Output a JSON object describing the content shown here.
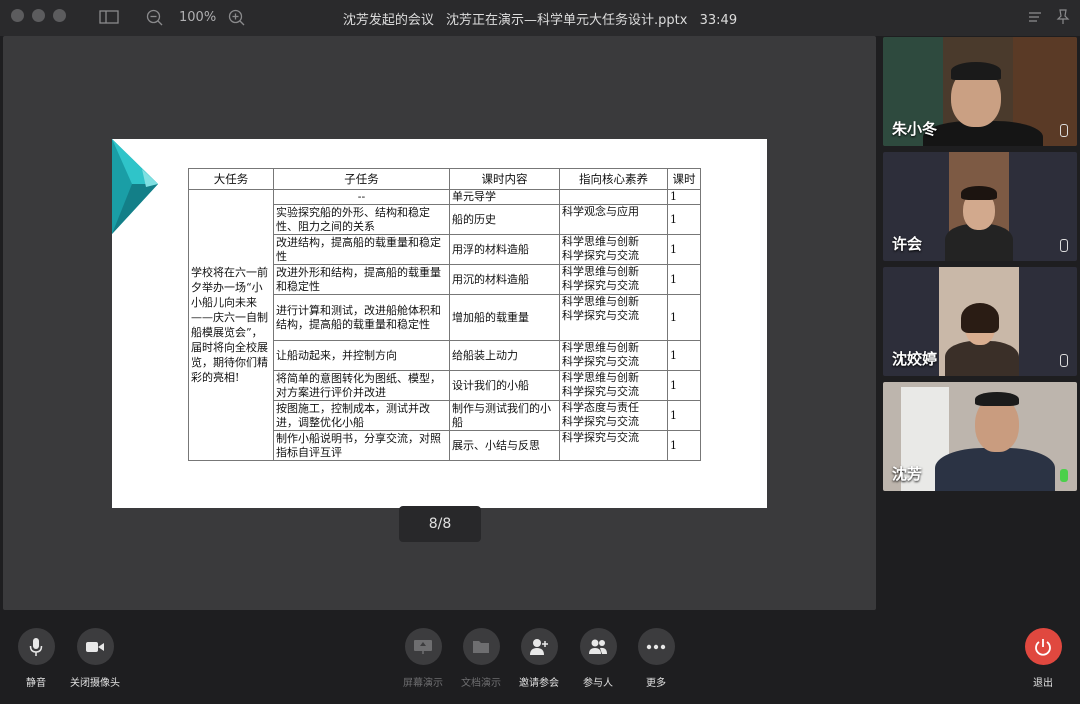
{
  "titlebar": {
    "zoom": "100%",
    "meeting_title": "沈芳发起的会议",
    "presenting": "沈芳正在演示—科学单元大任务设计.pptx",
    "timer": "33:49"
  },
  "slide": {
    "headers": [
      "大任务",
      "子任务",
      "课时内容",
      "指向核心素养",
      "课时"
    ],
    "main_task": "学校将在六一前夕举办一场“小小船儿向未来——庆六一自制船模展览会”，届时将向全校展览，期待你们精彩的亮相!",
    "rows": [
      {
        "sub": "--",
        "content": "单元导学",
        "literacy": "",
        "hours": "1"
      },
      {
        "sub": "实验探究船的外形、结构和稳定性、阻力之间的关系",
        "content": "船的历史",
        "literacy": "科学观念与应用",
        "hours": "1"
      },
      {
        "sub": "改进结构，提高船的载重量和稳定性",
        "content": "用浮的材料造船",
        "literacy": "科学思维与创新\n科学探究与交流",
        "hours": "1"
      },
      {
        "sub": "改进外形和结构，提高船的载重量和稳定性",
        "content": "用沉的材料造船",
        "literacy": "科学思维与创新\n科学探究与交流",
        "hours": "1"
      },
      {
        "sub": "进行计算和测试，改进船舱体积和结构，提高船的载重量和稳定性",
        "content": "增加船的载重量",
        "literacy": "科学思维与创新\n科学探究与交流",
        "hours": "1"
      },
      {
        "sub": "让船动起来，并控制方向",
        "content": "给船装上动力",
        "literacy": "科学思维与创新\n科学探究与交流",
        "hours": "1"
      },
      {
        "sub": "将简单的意图转化为图纸、模型，对方案进行评价并改进",
        "content": "设计我们的小船",
        "literacy": "科学思维与创新\n科学探究与交流",
        "hours": "1"
      },
      {
        "sub": "按图施工，控制成本，测试并改进，调整优化小船",
        "content": "制作与测试我们的小船",
        "literacy": "科学态度与责任\n科学探究与交流",
        "hours": "1"
      },
      {
        "sub": "制作小船说明书，分享交流，对照指标自评互评",
        "content": "展示、小结与反思",
        "literacy": "科学探究与交流",
        "hours": "1"
      }
    ]
  },
  "page_indicator": "8/8",
  "participants": [
    {
      "name": "朱小冬",
      "speaking": false
    },
    {
      "name": "许会",
      "speaking": false
    },
    {
      "name": "沈姣婷",
      "speaking": false
    },
    {
      "name": "沈芳",
      "speaking": true
    }
  ],
  "controls": {
    "mute": "静音",
    "camera": "关闭摄像头",
    "screen_share": "屏幕演示",
    "doc_share": "文档演示",
    "invite": "邀请参会",
    "participants": "参与人",
    "more": "更多",
    "leave": "退出"
  },
  "colors": {
    "accent_red": "#e0483f",
    "speaking_green": "#4bd04b",
    "slide_teal": "#1fb2b8"
  }
}
